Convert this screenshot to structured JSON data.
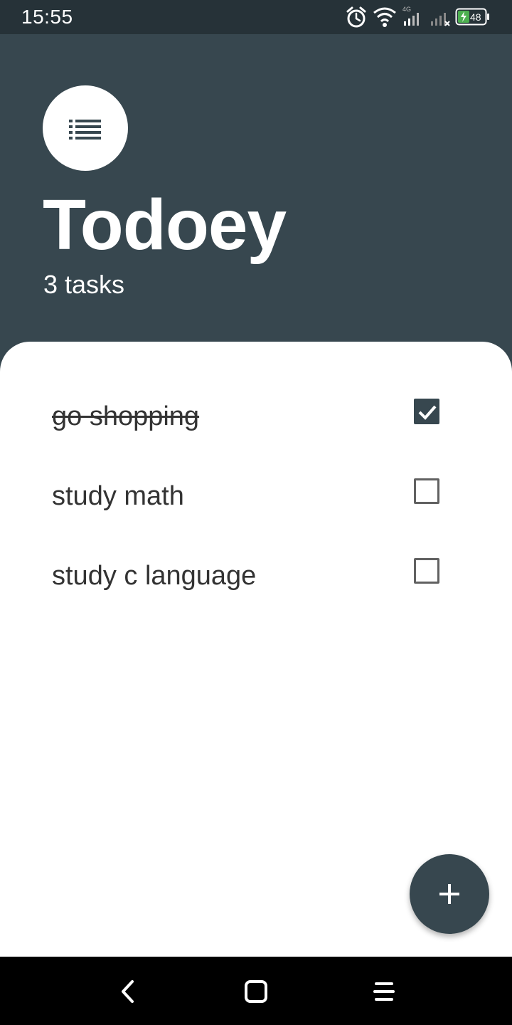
{
  "status_bar": {
    "time": "15:55",
    "network_label": "4G",
    "battery_level": "48",
    "icons": [
      "alarm-icon",
      "wifi-icon",
      "cellular-signal-icon",
      "cellular-signal-no-service-icon",
      "battery-charging-icon"
    ]
  },
  "header": {
    "icon": "list-icon",
    "title": "Todoey",
    "task_count": "3 tasks"
  },
  "tasks": [
    {
      "title": "go shopping",
      "done": true
    },
    {
      "title": "study math",
      "done": false
    },
    {
      "title": "study c language",
      "done": false
    }
  ],
  "fab": {
    "icon": "add-icon"
  },
  "nav_bar": {
    "icons": [
      "back-icon",
      "home-icon",
      "menu-icon"
    ]
  },
  "colors": {
    "primary": "#37474f",
    "status_bar": "#263238",
    "panel": "#ffffff",
    "battery_charge": "#4caf50"
  }
}
